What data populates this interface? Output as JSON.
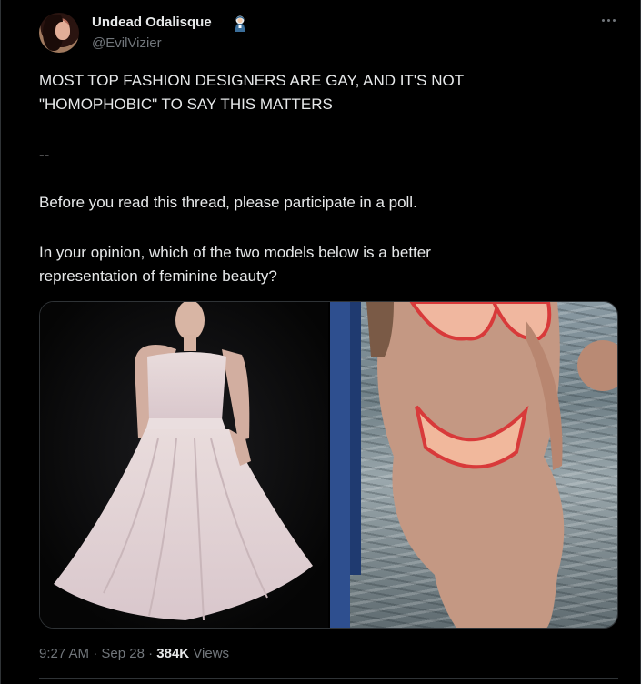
{
  "author": {
    "display_name": "Undead Odalisque",
    "handle": "@EvilVizier",
    "badge_icon": "nun-figure-emoji-icon",
    "avatar_icon": "profile-photo-avatar"
  },
  "tweet": {
    "headline_line1": "MOST TOP FASHION DESIGNERS ARE GAY, AND IT'S NOT",
    "headline_line2": "\"HOMOPHOBIC\" TO SAY THIS MATTERS",
    "separator": "--",
    "paragraph1": "Before you read this thread, please participate in a poll.",
    "paragraph2_line1": "In your opinion, which of the two models below is a better",
    "paragraph2_line2": "representation of feminine beauty?"
  },
  "media": {
    "left_photo": "runway-model-white-gown-photo",
    "right_photo": "beach-bikini-model-photo"
  },
  "meta": {
    "time": "9:27 AM",
    "dot1": "·",
    "date": "Sep 28",
    "dot2": "·",
    "views_count": "384K",
    "views_label": "Views"
  },
  "colors": {
    "background": "#000000",
    "text_primary": "#e7e9ea",
    "text_secondary": "#71767b",
    "border": "#2f3336"
  },
  "more_icon": "more-horizontal-icon"
}
